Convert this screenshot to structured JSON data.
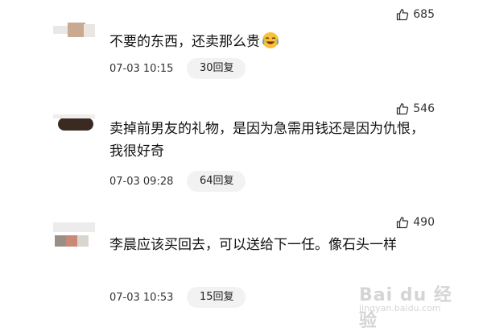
{
  "comments": [
    {
      "likes": "685",
      "text": "不要的东西，还卖那么贵",
      "time": "07-03 10:15",
      "replies": "30回复"
    },
    {
      "likes": "546",
      "text": "卖掉前男友的礼物，是因为急需用钱还是因为仇恨，我很好奇",
      "time": "07-03 09:28",
      "replies": "64回复"
    },
    {
      "likes": "490",
      "text": "李晨应该买回去，可以送给下一任。像石头一样",
      "time": "07-03 10:53",
      "replies": "15回复"
    }
  ],
  "icons": {
    "like": "thumbs-up-icon",
    "emoji": "laughing-crying-emoji-icon"
  },
  "watermark": {
    "brand": "Bai du 经验",
    "url": "jingyan.baidu.com"
  },
  "colors": {
    "reply_pill_bg": "#f2f2f2",
    "text": "#111111",
    "muted": "#333333"
  }
}
